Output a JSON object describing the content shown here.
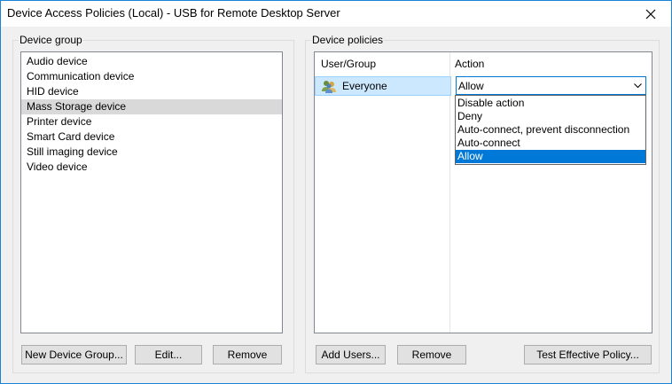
{
  "window": {
    "title": "Device Access Policies (Local) - USB for Remote Desktop Server",
    "close_icon": "close-icon"
  },
  "device_group": {
    "legend": "Device group",
    "items": [
      {
        "label": "Audio device",
        "selected": false
      },
      {
        "label": "Communication device",
        "selected": false
      },
      {
        "label": "HID device",
        "selected": false
      },
      {
        "label": "Mass Storage device",
        "selected": true
      },
      {
        "label": "Printer device",
        "selected": false
      },
      {
        "label": "Smart Card device",
        "selected": false
      },
      {
        "label": "Still imaging device",
        "selected": false
      },
      {
        "label": "Video device",
        "selected": false
      }
    ],
    "buttons": {
      "new_group": "New Device Group...",
      "edit": "Edit...",
      "remove": "Remove"
    }
  },
  "device_policies": {
    "legend": "Device policies",
    "columns": {
      "user_group": "User/Group",
      "action": "Action"
    },
    "rows": [
      {
        "user": "Everyone",
        "icon": "users-group-icon",
        "action": "Allow"
      }
    ],
    "action_options": [
      {
        "label": "Disable action",
        "selected": false
      },
      {
        "label": "Deny",
        "selected": false
      },
      {
        "label": "Auto-connect, prevent disconnection",
        "selected": false
      },
      {
        "label": "Auto-connect",
        "selected": false
      },
      {
        "label": "Allow",
        "selected": true
      }
    ],
    "buttons": {
      "add_users": "Add Users...",
      "remove": "Remove",
      "test_policy": "Test Effective Policy..."
    }
  },
  "colors": {
    "accent": "#0078d7",
    "row_highlight": "#cce8ff",
    "list_selection": "#d9d9d9",
    "window_border": "#1883d7"
  }
}
